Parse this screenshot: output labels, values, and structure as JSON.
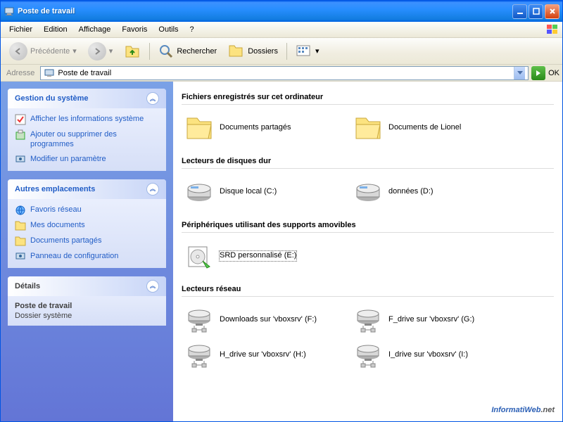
{
  "window": {
    "title": "Poste de travail"
  },
  "menubar": {
    "items": [
      "Fichier",
      "Edition",
      "Affichage",
      "Favoris",
      "Outils",
      "?"
    ]
  },
  "toolbar": {
    "back_label": "Précédente",
    "search_label": "Rechercher",
    "folders_label": "Dossiers"
  },
  "addressbar": {
    "label": "Adresse",
    "value": "Poste de travail",
    "go_label": "OK"
  },
  "sidebar": {
    "panels": {
      "system": {
        "title": "Gestion du système",
        "links": [
          "Afficher les informations système",
          "Ajouter ou supprimer des programmes",
          "Modifier un paramètre"
        ]
      },
      "places": {
        "title": "Autres emplacements",
        "links": [
          "Favoris réseau",
          "Mes documents",
          "Documents partagés",
          "Panneau de configuration"
        ]
      },
      "details": {
        "title": "Détails",
        "name": "Poste de travail",
        "type": "Dossier système"
      }
    }
  },
  "main": {
    "sections": [
      {
        "header": "Fichiers enregistrés sur cet ordinateur",
        "items": [
          {
            "label": "Documents partagés",
            "icon": "folder"
          },
          {
            "label": "Documents de Lionel",
            "icon": "folder"
          }
        ]
      },
      {
        "header": "Lecteurs de disques dur",
        "items": [
          {
            "label": "Disque local (C:)",
            "icon": "disk"
          },
          {
            "label": "données (D:)",
            "icon": "disk"
          }
        ]
      },
      {
        "header": "Périphériques utilisant des supports amovibles",
        "items": [
          {
            "label": "SRD personnalisé (E:)",
            "icon": "cd",
            "selected": true
          }
        ]
      },
      {
        "header": "Lecteurs réseau",
        "items": [
          {
            "label": "Downloads sur 'vboxsrv' (F:)",
            "icon": "netdrive"
          },
          {
            "label": "F_drive sur 'vboxsrv' (G:)",
            "icon": "netdrive"
          },
          {
            "label": "H_drive sur 'vboxsrv' (H:)",
            "icon": "netdrive"
          },
          {
            "label": "I_drive sur 'vboxsrv' (I:)",
            "icon": "netdrive"
          }
        ]
      }
    ]
  },
  "watermark": {
    "text": "InformatiWeb",
    "suffix": ".net"
  },
  "icons": {
    "folder": "folder-icon",
    "disk": "disk-icon",
    "cd": "cd-icon",
    "netdrive": "netdrive-icon"
  }
}
